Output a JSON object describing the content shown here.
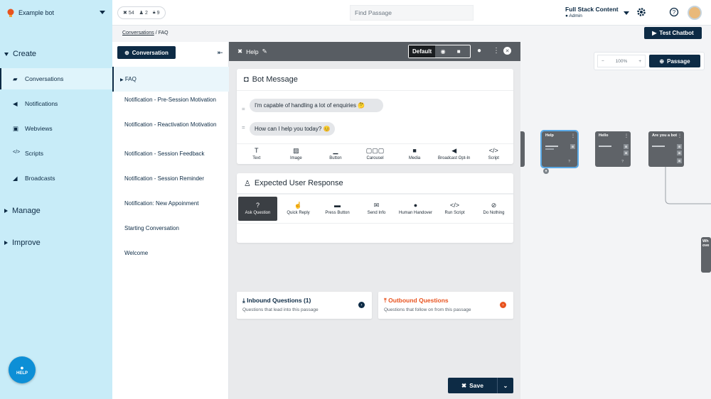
{
  "topbar": {
    "bot_name": "Example bot",
    "stats": {
      "passages": "54",
      "users": "2",
      "locks": "9"
    },
    "find_placeholder": "Find Passage",
    "account_title": "Full Stack Content",
    "account_role": "Admin"
  },
  "sidebar": {
    "create_label": "Create",
    "items": [
      {
        "label": "Conversations",
        "icon": "chat-icon"
      },
      {
        "label": "Notifications",
        "icon": "megaphone-icon"
      },
      {
        "label": "Webviews",
        "icon": "window-icon"
      },
      {
        "label": "Scripts",
        "icon": "code-icon"
      },
      {
        "label": "Broadcasts",
        "icon": "broadcast-icon"
      }
    ],
    "manage_label": "Manage",
    "improve_label": "Improve",
    "help_label": "HELP"
  },
  "breadcrumb": {
    "root": "Conversations",
    "sep": "/",
    "current": "FAQ"
  },
  "test_chatbot_label": "Test Chatbot",
  "conversations": {
    "new_label": "Conversation",
    "items": [
      "FAQ",
      "Notification - Pre-Session Motivation",
      "Notification - Reactivation Motivation",
      "Notification - Session Feedback",
      "Notification - Session Reminder",
      "Notification: New Appoinment",
      "Starting Conversation",
      "Welcome"
    ]
  },
  "editor": {
    "title": "Help",
    "channel_default": "Default",
    "bot_message": {
      "heading": "Bot Message",
      "messages": [
        "I'm capable of handling a lot of enquiries 🤔",
        "How can I help you today? 😊"
      ],
      "tools": [
        "Text",
        "Image",
        "Button",
        "Carousel",
        "Media",
        "Broadcast Opt-In",
        "Script"
      ]
    },
    "user_response": {
      "heading": "Expected User Response",
      "tools": [
        {
          "label": "Ask Question",
          "glyph": "?"
        },
        {
          "label": "Quick Reply",
          "glyph": "☝"
        },
        {
          "label": "Press Button",
          "glyph": "▬"
        },
        {
          "label": "Send Info",
          "glyph": "✉"
        },
        {
          "label": "Human Handover",
          "glyph": "●"
        },
        {
          "label": "Run Script",
          "glyph": "</>"
        },
        {
          "label": "Do Nothing",
          "glyph": "⊘"
        }
      ]
    },
    "inbound": {
      "title": "Inbound Questions (1)",
      "subtitle": "Questions that lead into this passage"
    },
    "outbound": {
      "title": "Outbound Questions",
      "subtitle": "Questions that follow on from this passage"
    },
    "save_label": "Save"
  },
  "canvas": {
    "zoom": "100%",
    "passage_label": "Passage",
    "nodes": [
      "Help",
      "Hello",
      "Are you a bot",
      "Wh ove"
    ],
    "node_badge": "?"
  },
  "colors": {
    "navy": "#0d2b45",
    "sidebar": "#c8ecf8",
    "accent_blue": "#0d8fd6",
    "outbound_orange": "#e8531f"
  }
}
